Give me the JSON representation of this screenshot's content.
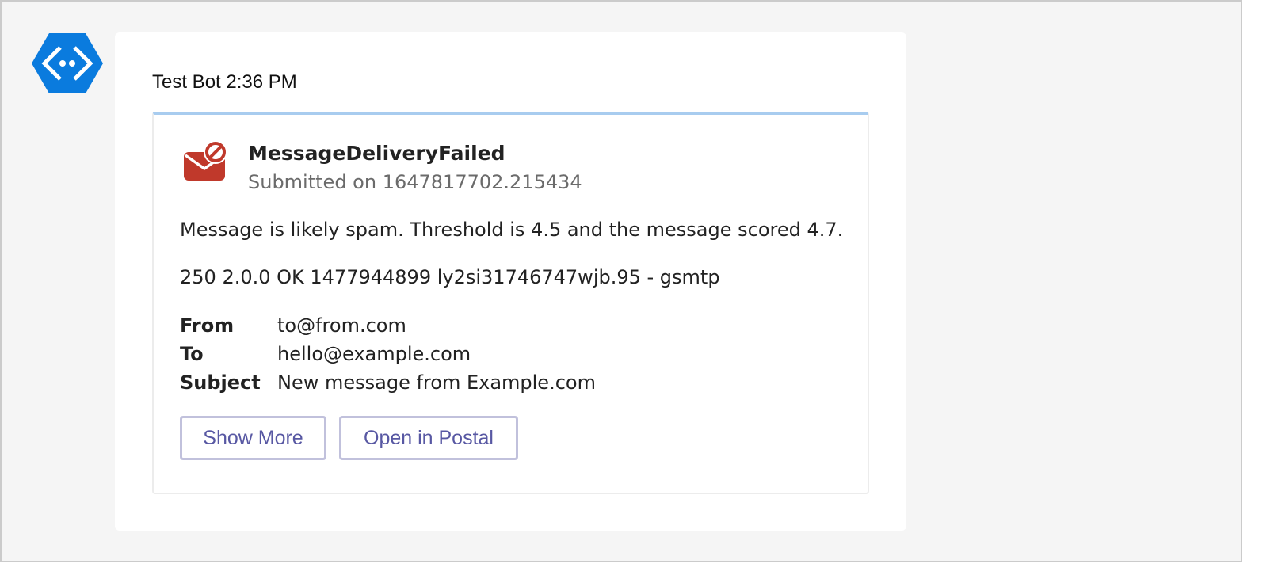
{
  "message": {
    "sender": "Test Bot",
    "time": "2:36 PM",
    "avatar_icon": "bot-avatar-icon",
    "avatar_color": "#0a7bde"
  },
  "card": {
    "icon": "email-blocked-icon",
    "icon_color": "#c0392b",
    "accent_color": "#a8ccef",
    "title": "MessageDeliveryFailed",
    "subtitle": "Submitted on 1647817702.215434",
    "details": "Message is likely spam. Threshold is 4.5 and the message scored 4.7.",
    "smtp_output": "250 2.0.0 OK 1477944899 ly2si31746747wjb.95 - gsmtp",
    "facts": [
      {
        "key": "From",
        "value": "to@from.com"
      },
      {
        "key": "To",
        "value": "hello@example.com"
      },
      {
        "key": "Subject",
        "value": "New message from Example.com"
      }
    ],
    "actions": [
      {
        "label": "Show More"
      },
      {
        "label": "Open in Postal"
      }
    ]
  }
}
